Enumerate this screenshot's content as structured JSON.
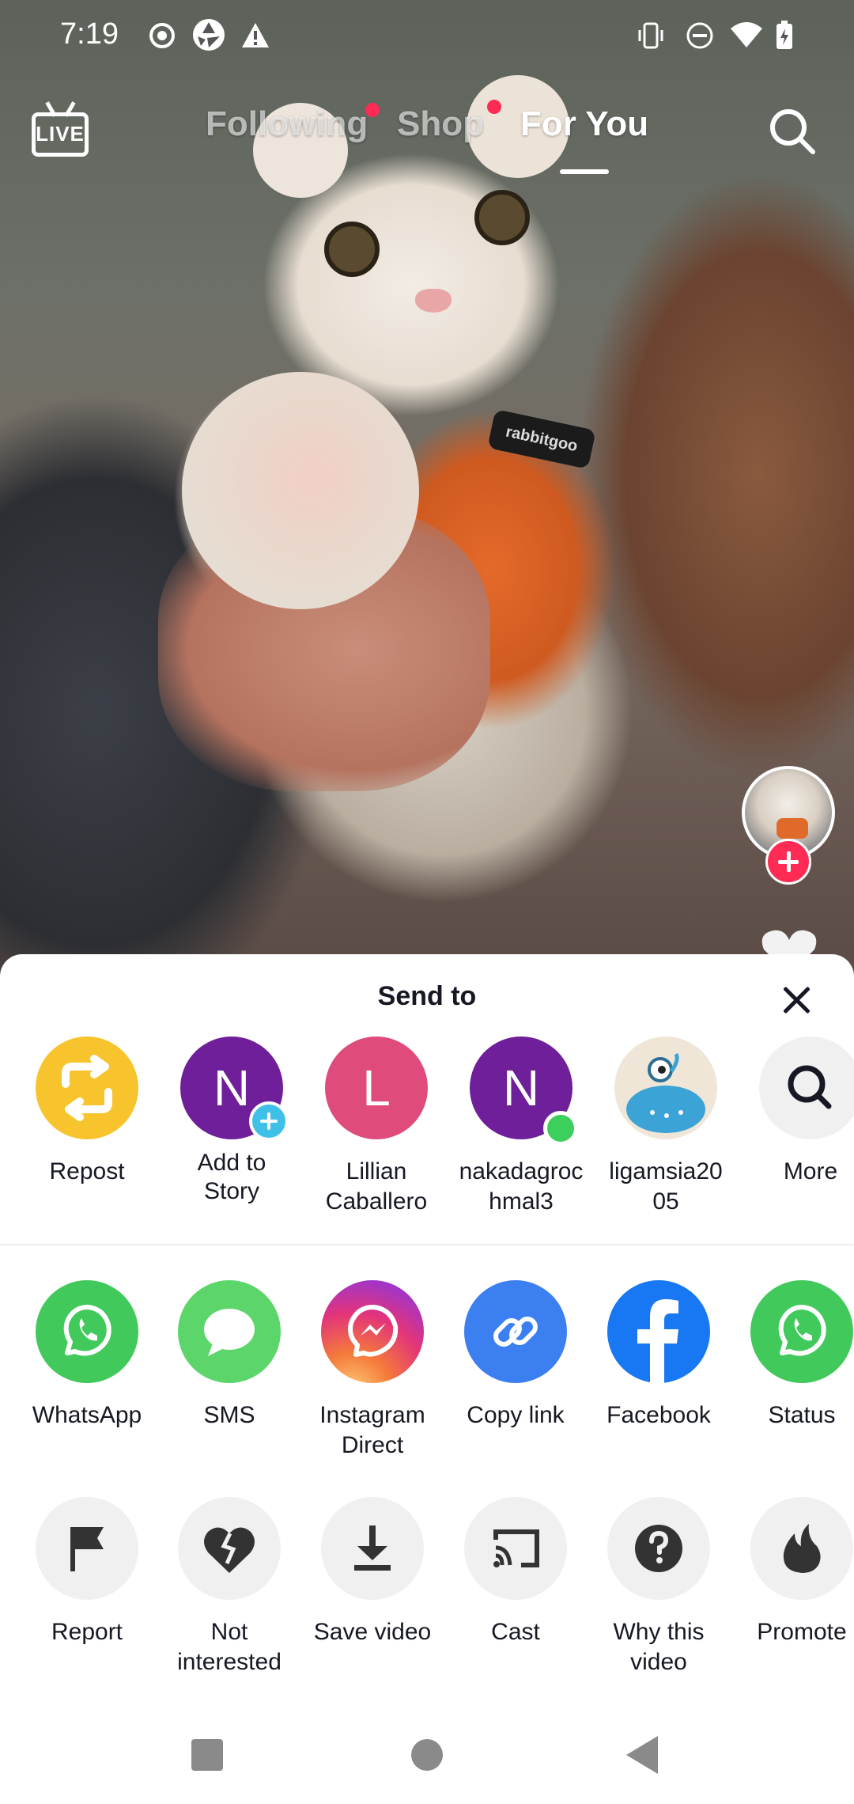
{
  "status_bar": {
    "time": "7:19",
    "left_icons": [
      "record-icon",
      "camera-shutter-icon",
      "warning-icon"
    ],
    "right_icons": [
      "vibrate-icon",
      "do-not-disturb-icon",
      "wifi-icon",
      "battery-charging-icon"
    ]
  },
  "top_nav": {
    "live_label": "LIVE",
    "tabs": [
      {
        "label": "Following",
        "has_dot": true,
        "active": false
      },
      {
        "label": "Shop",
        "has_dot": true,
        "active": false
      },
      {
        "label": "For You",
        "has_dot": false,
        "active": true
      }
    ],
    "search_icon": "search-icon"
  },
  "video": {
    "harness_text": "rabbitgoo"
  },
  "share_sheet": {
    "title": "Send to",
    "contacts": [
      {
        "label": "Repost",
        "icon": "repost-icon"
      },
      {
        "label": "Add to\nStory",
        "letter": "N"
      },
      {
        "label": "Lillian\nCaballero",
        "letter": "L"
      },
      {
        "label": "nakadagroc\nhmal3",
        "letter": "N"
      },
      {
        "label": "ligamsia20\n05",
        "icon": "monster-avatar"
      },
      {
        "label": "More",
        "icon": "search-icon"
      }
    ],
    "apps": [
      {
        "label": "WhatsApp",
        "icon": "whatsapp-icon"
      },
      {
        "label": "SMS",
        "icon": "sms-icon"
      },
      {
        "label": "Instagram\nDirect",
        "icon": "messenger-icon"
      },
      {
        "label": "Copy link",
        "icon": "link-icon"
      },
      {
        "label": "Facebook",
        "icon": "facebook-icon"
      },
      {
        "label": "Status",
        "icon": "whatsapp-icon"
      }
    ],
    "actions": [
      {
        "label": "Report",
        "icon": "flag-icon"
      },
      {
        "label": "Not\ninterested",
        "icon": "broken-heart-icon"
      },
      {
        "label": "Save video",
        "icon": "download-icon"
      },
      {
        "label": "Cast",
        "icon": "cast-icon"
      },
      {
        "label": "Why this\nvideo",
        "icon": "question-icon"
      },
      {
        "label": "Promote",
        "icon": "flame-icon"
      }
    ]
  },
  "nav_bar": {
    "buttons": [
      "recents-button",
      "home-button",
      "back-button"
    ]
  }
}
